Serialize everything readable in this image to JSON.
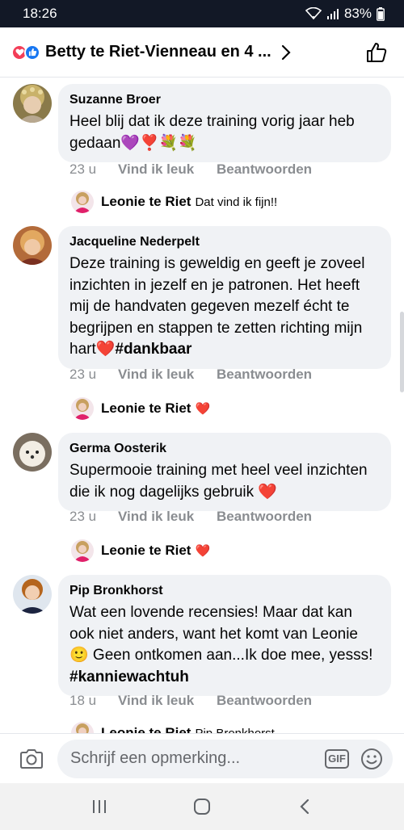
{
  "status_bar": {
    "time": "18:26",
    "battery": "83%",
    "icons": [
      "wifi-icon",
      "signal-icon",
      "battery-icon"
    ]
  },
  "header": {
    "title": "Betty te Riet-Vienneau en 4 ...",
    "reaction_icons": [
      "love-reaction-icon",
      "like-reaction-icon"
    ],
    "like_icon": "thumbs-up-icon"
  },
  "comments": [
    {
      "author": "Suzanne Broer",
      "text": "Heel blij dat ik deze training vorig jaar heb gedaan💜❣️💐💐",
      "time": "23 u",
      "like_label": "Vind ik leuk",
      "reply_label": "Beantwoorden",
      "reply": {
        "author": "Leonie te Riet",
        "text": "Dat vind ik fijn!!"
      }
    },
    {
      "author": "Jacqueline Nederpelt",
      "text": "Deze training is geweldig en geeft je zoveel inzichten in jezelf en je patronen. Het heeft mij de handvaten gegeven mezelf écht te begrijpen en stappen te zetten richting mijn hart❤️",
      "hashtag": "#dankbaar",
      "time": "23 u",
      "like_label": "Vind ik leuk",
      "reply_label": "Beantwoorden",
      "reply": {
        "author": "Leonie te Riet",
        "text": "❤️"
      }
    },
    {
      "author": "Germa Oosterik",
      "text": "Supermooie training met heel veel inzichten die ik nog dagelijks gebruik ❤️",
      "time": "23 u",
      "like_label": "Vind ik leuk",
      "reply_label": "Beantwoorden",
      "reply": {
        "author": "Leonie te Riet",
        "text": "❤️"
      }
    },
    {
      "author": "Pip Bronkhorst",
      "text": "Wat een lovende recensies! Maar dat kan ook niet anders, want het komt van Leonie 🙂 Geen ontkomen aan...Ik doe mee, yesss! ",
      "hashtag": "#kanniewachtuh",
      "time": "18 u",
      "like_label": "Vind ik leuk",
      "reply_label": "Beantwoorden",
      "reply": {
        "author": "Leonie te Riet",
        "text": "Pip Bronkhorst"
      }
    }
  ],
  "composer": {
    "placeholder": "Schrijf een opmerking...",
    "gif_label": "GIF"
  },
  "colors": {
    "status_bar_bg": "#121826",
    "bubble_bg": "#f0f2f5",
    "meta_text": "#8a8d91",
    "love_red": "#f33e58",
    "like_blue": "#1877f2"
  }
}
